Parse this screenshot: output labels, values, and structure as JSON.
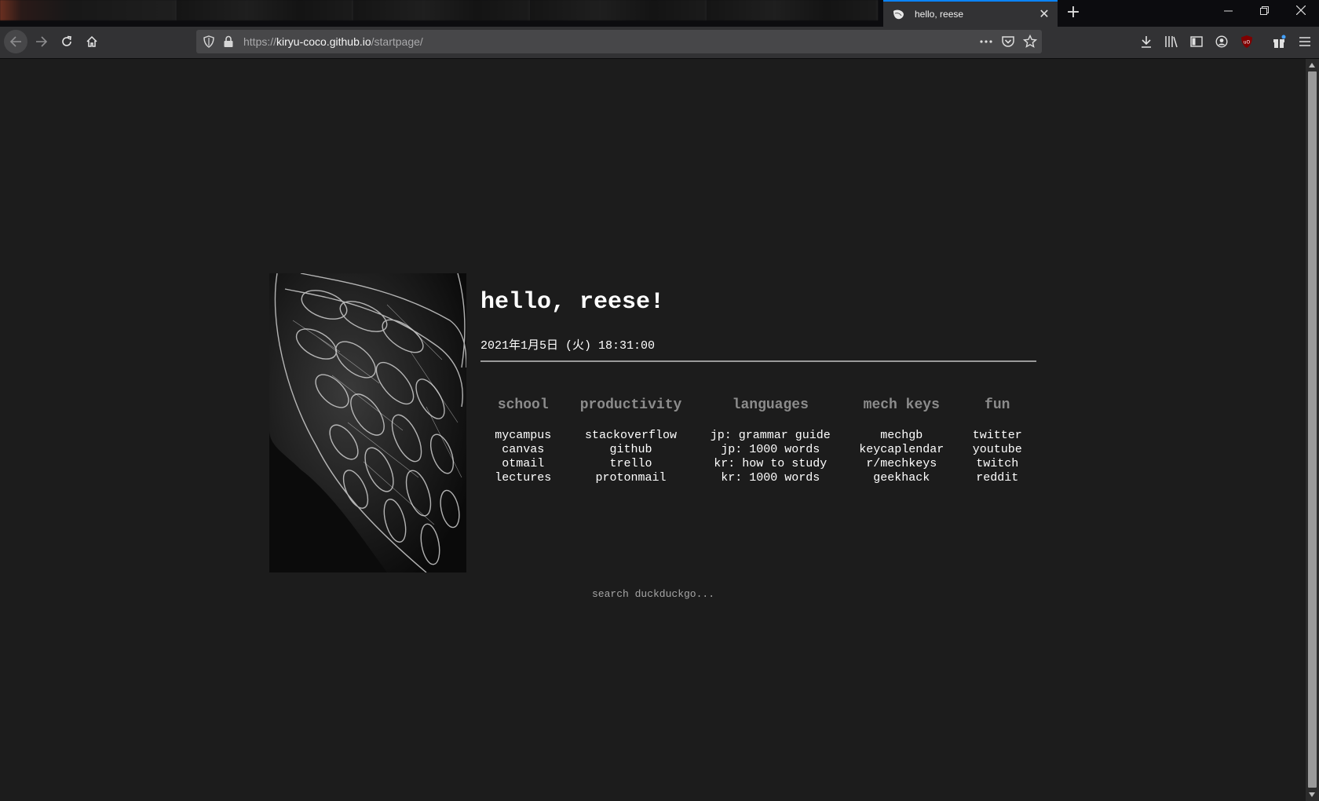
{
  "browser": {
    "active_tab_title": "hello, reese",
    "url_scheme": "https://",
    "url_host": "kiryu-coco.github.io",
    "url_path": "/startpage/"
  },
  "page": {
    "greeting": "hello, reese!",
    "datetime": "2021年1月5日 (火) 18:31:00",
    "search_placeholder": "search duckduckgo...",
    "columns": [
      {
        "title": "school",
        "links": [
          "mycampus",
          "canvas",
          "otmail",
          "lectures"
        ]
      },
      {
        "title": "productivity",
        "links": [
          "stackoverflow",
          "github",
          "trello",
          "protonmail"
        ]
      },
      {
        "title": "languages",
        "links": [
          "jp: grammar guide",
          "jp: 1000 words",
          "kr: how to study",
          "kr: 1000 words"
        ]
      },
      {
        "title": "mech keys",
        "links": [
          "mechgb",
          "keycaplendar",
          "r/mechkeys",
          "geekhack"
        ]
      },
      {
        "title": "fun",
        "links": [
          "twitter",
          "youtube",
          "twitch",
          "reddit"
        ]
      }
    ]
  },
  "colors": {
    "background": "#1c1c1c",
    "accent": "#0a84ff",
    "heading": "#8c8c8c"
  }
}
